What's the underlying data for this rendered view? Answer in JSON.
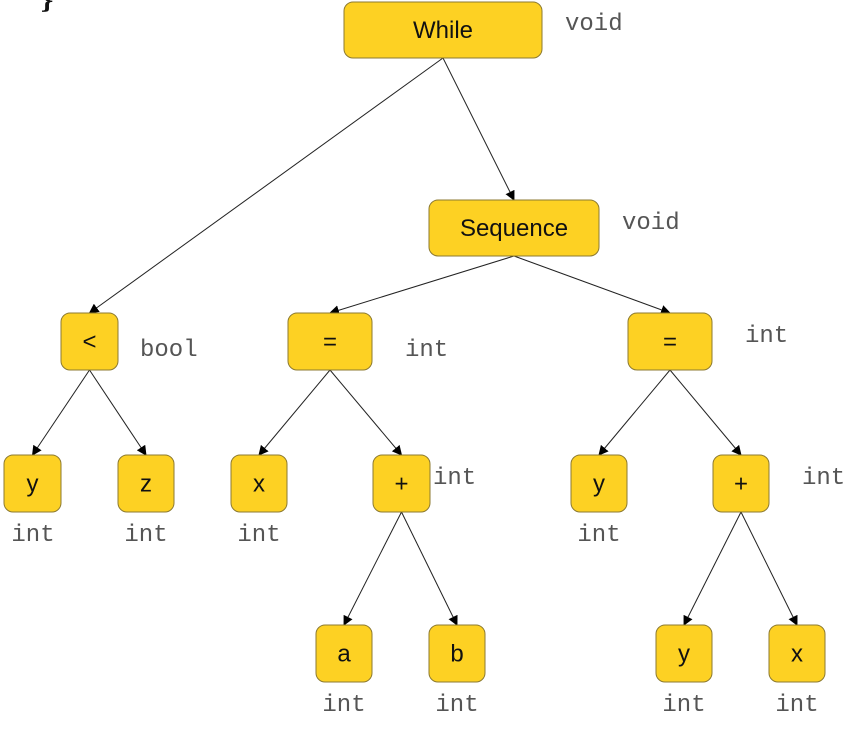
{
  "code_fragment": "}",
  "colors": {
    "node_fill": "#fdd123",
    "node_stroke": "#8c7a32",
    "edge": "#222222",
    "type_text": "#555555"
  },
  "nodes": [
    {
      "id": "while",
      "label": "While",
      "type": "void",
      "children": [
        "less",
        "seq"
      ]
    },
    {
      "id": "seq",
      "label": "Sequence",
      "type": "void",
      "children": [
        "assign1",
        "assign2"
      ]
    },
    {
      "id": "less",
      "label": "<",
      "type": "bool",
      "children": [
        "y1",
        "z1"
      ]
    },
    {
      "id": "assign1",
      "label": "=",
      "type": "int",
      "children": [
        "x1",
        "plus1"
      ]
    },
    {
      "id": "assign2",
      "label": "=",
      "type": "int",
      "children": [
        "y2",
        "plus2"
      ]
    },
    {
      "id": "y1",
      "label": "y",
      "type": "int",
      "children": []
    },
    {
      "id": "z1",
      "label": "z",
      "type": "int",
      "children": []
    },
    {
      "id": "x1",
      "label": "x",
      "type": "int",
      "children": []
    },
    {
      "id": "plus1",
      "label": "+",
      "type": "int",
      "children": [
        "a1",
        "b1"
      ]
    },
    {
      "id": "y2",
      "label": "y",
      "type": "int",
      "children": []
    },
    {
      "id": "plus2",
      "label": "+",
      "type": "int",
      "children": [
        "y3",
        "x2"
      ]
    },
    {
      "id": "a1",
      "label": "a",
      "type": "int",
      "children": []
    },
    {
      "id": "b1",
      "label": "b",
      "type": "int",
      "children": []
    },
    {
      "id": "y3",
      "label": "y",
      "type": "int",
      "children": []
    },
    {
      "id": "x2",
      "label": "x",
      "type": "int",
      "children": []
    }
  ]
}
